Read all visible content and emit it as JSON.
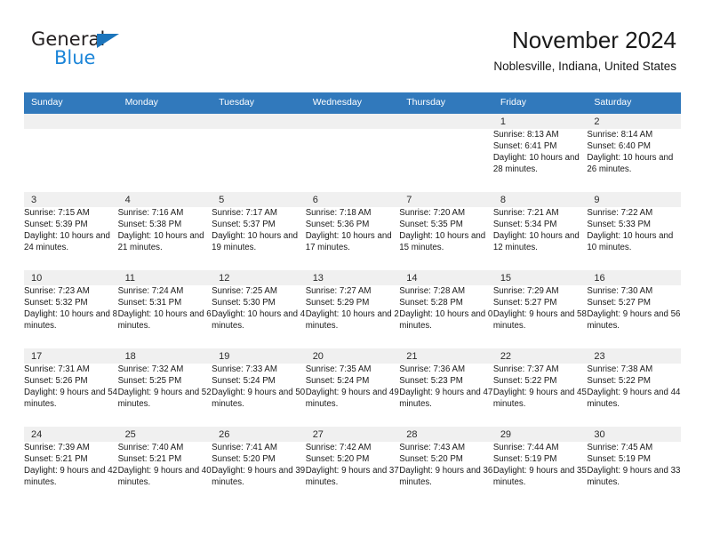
{
  "brand": {
    "name_top": "General",
    "name_bottom": "Blue",
    "triangle_color": "#1c75bc",
    "blue_text_color": "#1c85d8"
  },
  "header": {
    "title": "November 2024",
    "subtitle": "Noblesville, Indiana, United States"
  },
  "theme": {
    "header_row_bg": "#3179bc",
    "header_row_text": "#ffffff",
    "daynum_band_bg": "#f0f0f0",
    "row_divider": "#3179bc",
    "cell_bg": "#ffffff",
    "text": "#1a1a1a"
  },
  "calendar": {
    "weekday_headers": [
      "Sunday",
      "Monday",
      "Tuesday",
      "Wednesday",
      "Thursday",
      "Friday",
      "Saturday"
    ],
    "weeks": [
      [
        {
          "day": "",
          "sunrise": "",
          "sunset": "",
          "daylight": ""
        },
        {
          "day": "",
          "sunrise": "",
          "sunset": "",
          "daylight": ""
        },
        {
          "day": "",
          "sunrise": "",
          "sunset": "",
          "daylight": ""
        },
        {
          "day": "",
          "sunrise": "",
          "sunset": "",
          "daylight": ""
        },
        {
          "day": "",
          "sunrise": "",
          "sunset": "",
          "daylight": ""
        },
        {
          "day": "1",
          "sunrise": "Sunrise: 8:13 AM",
          "sunset": "Sunset: 6:41 PM",
          "daylight": "Daylight: 10 hours and 28 minutes."
        },
        {
          "day": "2",
          "sunrise": "Sunrise: 8:14 AM",
          "sunset": "Sunset: 6:40 PM",
          "daylight": "Daylight: 10 hours and 26 minutes."
        }
      ],
      [
        {
          "day": "3",
          "sunrise": "Sunrise: 7:15 AM",
          "sunset": "Sunset: 5:39 PM",
          "daylight": "Daylight: 10 hours and 24 minutes."
        },
        {
          "day": "4",
          "sunrise": "Sunrise: 7:16 AM",
          "sunset": "Sunset: 5:38 PM",
          "daylight": "Daylight: 10 hours and 21 minutes."
        },
        {
          "day": "5",
          "sunrise": "Sunrise: 7:17 AM",
          "sunset": "Sunset: 5:37 PM",
          "daylight": "Daylight: 10 hours and 19 minutes."
        },
        {
          "day": "6",
          "sunrise": "Sunrise: 7:18 AM",
          "sunset": "Sunset: 5:36 PM",
          "daylight": "Daylight: 10 hours and 17 minutes."
        },
        {
          "day": "7",
          "sunrise": "Sunrise: 7:20 AM",
          "sunset": "Sunset: 5:35 PM",
          "daylight": "Daylight: 10 hours and 15 minutes."
        },
        {
          "day": "8",
          "sunrise": "Sunrise: 7:21 AM",
          "sunset": "Sunset: 5:34 PM",
          "daylight": "Daylight: 10 hours and 12 minutes."
        },
        {
          "day": "9",
          "sunrise": "Sunrise: 7:22 AM",
          "sunset": "Sunset: 5:33 PM",
          "daylight": "Daylight: 10 hours and 10 minutes."
        }
      ],
      [
        {
          "day": "10",
          "sunrise": "Sunrise: 7:23 AM",
          "sunset": "Sunset: 5:32 PM",
          "daylight": "Daylight: 10 hours and 8 minutes."
        },
        {
          "day": "11",
          "sunrise": "Sunrise: 7:24 AM",
          "sunset": "Sunset: 5:31 PM",
          "daylight": "Daylight: 10 hours and 6 minutes."
        },
        {
          "day": "12",
          "sunrise": "Sunrise: 7:25 AM",
          "sunset": "Sunset: 5:30 PM",
          "daylight": "Daylight: 10 hours and 4 minutes."
        },
        {
          "day": "13",
          "sunrise": "Sunrise: 7:27 AM",
          "sunset": "Sunset: 5:29 PM",
          "daylight": "Daylight: 10 hours and 2 minutes."
        },
        {
          "day": "14",
          "sunrise": "Sunrise: 7:28 AM",
          "sunset": "Sunset: 5:28 PM",
          "daylight": "Daylight: 10 hours and 0 minutes."
        },
        {
          "day": "15",
          "sunrise": "Sunrise: 7:29 AM",
          "sunset": "Sunset: 5:27 PM",
          "daylight": "Daylight: 9 hours and 58 minutes."
        },
        {
          "day": "16",
          "sunrise": "Sunrise: 7:30 AM",
          "sunset": "Sunset: 5:27 PM",
          "daylight": "Daylight: 9 hours and 56 minutes."
        }
      ],
      [
        {
          "day": "17",
          "sunrise": "Sunrise: 7:31 AM",
          "sunset": "Sunset: 5:26 PM",
          "daylight": "Daylight: 9 hours and 54 minutes."
        },
        {
          "day": "18",
          "sunrise": "Sunrise: 7:32 AM",
          "sunset": "Sunset: 5:25 PM",
          "daylight": "Daylight: 9 hours and 52 minutes."
        },
        {
          "day": "19",
          "sunrise": "Sunrise: 7:33 AM",
          "sunset": "Sunset: 5:24 PM",
          "daylight": "Daylight: 9 hours and 50 minutes."
        },
        {
          "day": "20",
          "sunrise": "Sunrise: 7:35 AM",
          "sunset": "Sunset: 5:24 PM",
          "daylight": "Daylight: 9 hours and 49 minutes."
        },
        {
          "day": "21",
          "sunrise": "Sunrise: 7:36 AM",
          "sunset": "Sunset: 5:23 PM",
          "daylight": "Daylight: 9 hours and 47 minutes."
        },
        {
          "day": "22",
          "sunrise": "Sunrise: 7:37 AM",
          "sunset": "Sunset: 5:22 PM",
          "daylight": "Daylight: 9 hours and 45 minutes."
        },
        {
          "day": "23",
          "sunrise": "Sunrise: 7:38 AM",
          "sunset": "Sunset: 5:22 PM",
          "daylight": "Daylight: 9 hours and 44 minutes."
        }
      ],
      [
        {
          "day": "24",
          "sunrise": "Sunrise: 7:39 AM",
          "sunset": "Sunset: 5:21 PM",
          "daylight": "Daylight: 9 hours and 42 minutes."
        },
        {
          "day": "25",
          "sunrise": "Sunrise: 7:40 AM",
          "sunset": "Sunset: 5:21 PM",
          "daylight": "Daylight: 9 hours and 40 minutes."
        },
        {
          "day": "26",
          "sunrise": "Sunrise: 7:41 AM",
          "sunset": "Sunset: 5:20 PM",
          "daylight": "Daylight: 9 hours and 39 minutes."
        },
        {
          "day": "27",
          "sunrise": "Sunrise: 7:42 AM",
          "sunset": "Sunset: 5:20 PM",
          "daylight": "Daylight: 9 hours and 37 minutes."
        },
        {
          "day": "28",
          "sunrise": "Sunrise: 7:43 AM",
          "sunset": "Sunset: 5:20 PM",
          "daylight": "Daylight: 9 hours and 36 minutes."
        },
        {
          "day": "29",
          "sunrise": "Sunrise: 7:44 AM",
          "sunset": "Sunset: 5:19 PM",
          "daylight": "Daylight: 9 hours and 35 minutes."
        },
        {
          "day": "30",
          "sunrise": "Sunrise: 7:45 AM",
          "sunset": "Sunset: 5:19 PM",
          "daylight": "Daylight: 9 hours and 33 minutes."
        }
      ]
    ]
  }
}
